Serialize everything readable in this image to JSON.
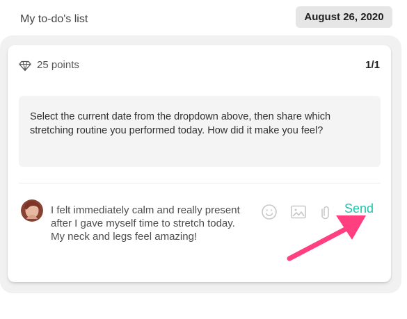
{
  "header": {
    "title": "My to-do's list",
    "date": "August 26, 2020"
  },
  "card": {
    "points_label": "25 points",
    "page_count": "1/1",
    "prompt": "Select the current date from the dropdown above, then share which stretching routine you performed today. How did it make you feel?",
    "reply": "I felt immediately calm and really present after I gave myself time to stretch today. My neck and legs feel amazing!",
    "send_label": "Send"
  },
  "icons": {
    "points": "diamond-icon",
    "emoji": "emoji-icon",
    "image": "image-icon",
    "attachment": "paperclip-icon",
    "pointer": "arrow-icon"
  },
  "colors": {
    "accent": "#20c1ad",
    "arrow": "#ff3f7f"
  }
}
